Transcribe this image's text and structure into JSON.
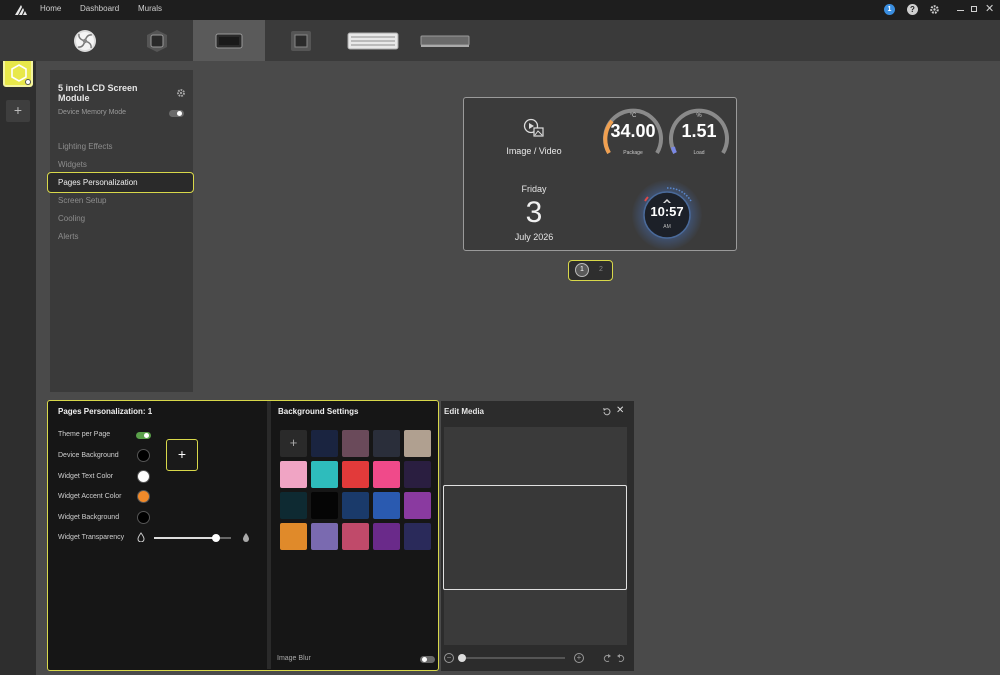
{
  "titlebar": {
    "nav": [
      "Home",
      "Dashboard",
      "Murals"
    ],
    "notification_count": "1",
    "help_icon": "question-icon",
    "settings_icon": "gear-icon",
    "window_controls": [
      "minimize",
      "maximize",
      "close"
    ]
  },
  "devices": [
    "fan",
    "pump-block",
    "lcd-screen-module",
    "lcd-square",
    "keyboard",
    "memory-module"
  ],
  "settings_panel": {
    "title": "5 inch LCD Screen Module",
    "memory_mode_label": "Device Memory Mode",
    "memory_mode_on": false,
    "menu": [
      "Lighting Effects",
      "Widgets",
      "Pages Personalization",
      "Screen Setup",
      "Cooling",
      "Alerts"
    ],
    "selected": "Pages Personalization"
  },
  "preview": {
    "media_label": "Image / Video",
    "gauge1": {
      "unit": "°C",
      "value": "34.00",
      "label": "Package",
      "color": "#f0a050"
    },
    "gauge2": {
      "unit": "%",
      "value": "1.51",
      "label": "Load",
      "color": "#7a88e6"
    },
    "day_name": "Friday",
    "day_num": "3",
    "month_year": "July 2026",
    "clock_time": "10:57",
    "clock_ampm": "AM",
    "pages": [
      "1",
      "2"
    ],
    "active_page": "1"
  },
  "pages_personalization": {
    "title": "Pages Personalization: 1",
    "theme_per_page_label": "Theme per Page",
    "theme_per_page_on": true,
    "device_background_label": "Device Background",
    "widget_text_color_label": "Widget Text Color",
    "widget_accent_color_label": "Widget Accent Color",
    "widget_background_label": "Widget Background",
    "widget_transparency_label": "Widget Transparency",
    "widget_transparency_value": 0.81,
    "colors": {
      "device_background": "#000000",
      "widget_text": "#ffffff",
      "widget_accent": "#f08a2a",
      "widget_background": "#000000"
    }
  },
  "background_settings": {
    "title": "Background Settings",
    "swatch_colors": [
      "add",
      "#1a2440",
      "#6a4a5a",
      "#2a2e3a",
      "#b0a090",
      "#f0a4c4",
      "#2ebcbc",
      "#e23a3a",
      "#f04a8a",
      "#2a1e40",
      "#0e2a32",
      "#050505",
      "#1a3a6a",
      "#2a5ab0",
      "#8a3aa0",
      "#e08a2a",
      "#7a6ab0",
      "#c04a6a",
      "#6a2a8a",
      "#2a2a5a"
    ],
    "image_blur_label": "Image Blur",
    "image_blur_on": false
  },
  "edit_media": {
    "title": "Edit Media",
    "zoom_value": 0.0
  }
}
